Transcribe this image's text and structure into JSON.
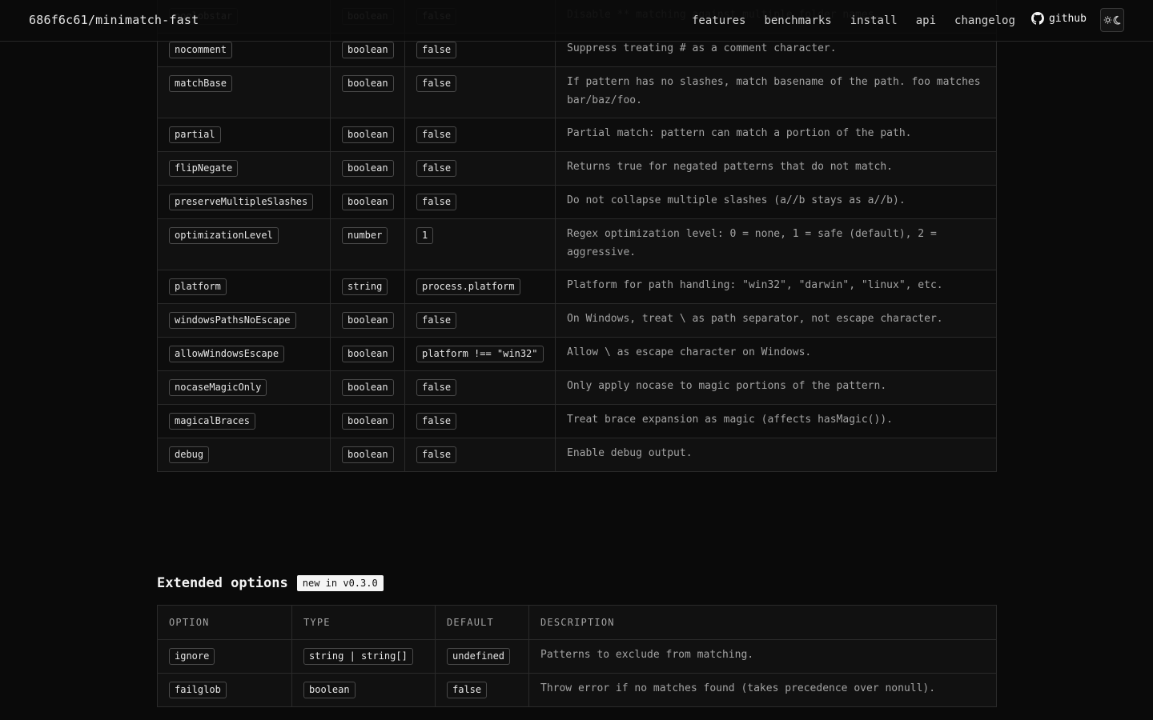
{
  "header": {
    "brand": "686f6c61/minimatch-fast",
    "nav": [
      "features",
      "benchmarks",
      "install",
      "api",
      "changelog"
    ],
    "github": "github"
  },
  "options_table": {
    "rows": [
      {
        "option": "noglobstar",
        "type": "boolean",
        "default": "false",
        "description": "Disable ** matching against multiple folder names."
      },
      {
        "option": "nocomment",
        "type": "boolean",
        "default": "false",
        "description": "Suppress treating # as a comment character."
      },
      {
        "option": "matchBase",
        "type": "boolean",
        "default": "false",
        "description": "If pattern has no slashes, match basename of the path. foo matches bar/baz/foo."
      },
      {
        "option": "partial",
        "type": "boolean",
        "default": "false",
        "description": "Partial match: pattern can match a portion of the path."
      },
      {
        "option": "flipNegate",
        "type": "boolean",
        "default": "false",
        "description": "Returns true for negated patterns that do not match."
      },
      {
        "option": "preserveMultipleSlashes",
        "type": "boolean",
        "default": "false",
        "description": "Do not collapse multiple slashes (a//b stays as a//b)."
      },
      {
        "option": "optimizationLevel",
        "type": "number",
        "default": "1",
        "description": "Regex optimization level: 0 = none, 1 = safe (default), 2 = aggressive."
      },
      {
        "option": "platform",
        "type": "string",
        "default": "process.platform",
        "description": "Platform for path handling: \"win32\", \"darwin\", \"linux\", etc."
      },
      {
        "option": "windowsPathsNoEscape",
        "type": "boolean",
        "default": "false",
        "description": "On Windows, treat \\ as path separator, not escape character."
      },
      {
        "option": "allowWindowsEscape",
        "type": "boolean",
        "default": "platform !== \"win32\"",
        "description": "Allow \\ as escape character on Windows."
      },
      {
        "option": "nocaseMagicOnly",
        "type": "boolean",
        "default": "false",
        "description": "Only apply nocase to magic portions of the pattern."
      },
      {
        "option": "magicalBraces",
        "type": "boolean",
        "default": "false",
        "description": "Treat brace expansion as magic (affects hasMagic())."
      },
      {
        "option": "debug",
        "type": "boolean",
        "default": "false",
        "description": "Enable debug output."
      }
    ]
  },
  "extended": {
    "title": "Extended options",
    "badge": "new in v0.3.0",
    "columns": [
      "OPTION",
      "TYPE",
      "DEFAULT",
      "DESCRIPTION"
    ],
    "rows": [
      {
        "option": "ignore",
        "type": "string | string[]",
        "default": "undefined",
        "description": "Patterns to exclude from matching."
      },
      {
        "option": "failglob",
        "type": "boolean",
        "default": "false",
        "description": "Throw error if no matches found (takes precedence over nonull)."
      }
    ]
  }
}
